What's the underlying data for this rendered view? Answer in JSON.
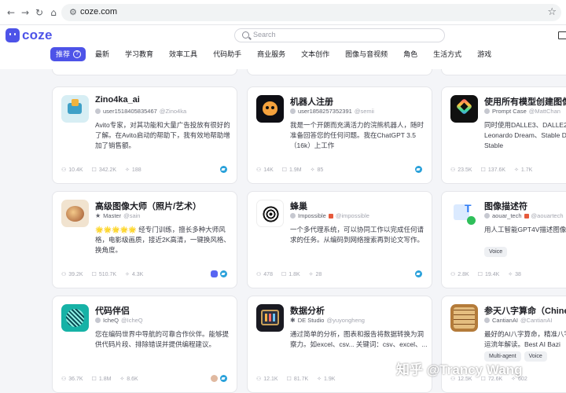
{
  "browser": {
    "url": "coze.com"
  },
  "header": {
    "logo_text": "coze",
    "search_placeholder": "Search"
  },
  "tabs": [
    "推荐",
    "最新",
    "学习教育",
    "效率工具",
    "代码助手",
    "商业服务",
    "文本创作",
    "图像与音视频",
    "角色",
    "生活方式",
    "游戏"
  ],
  "cards": [
    {
      "title": "Zino4ka_ai",
      "author": "user1518405835467",
      "handle": "@Zino4ka",
      "desc": "Avito专家，对其功能和大量广告投放有很好的了解。在Avito启动的帮助下，我有效地帮助增加了销售额。",
      "tags": [],
      "stats": [
        "10.4K",
        "342.2K",
        "188"
      ],
      "icon": "cart-robot-icon"
    },
    {
      "title": "机器人注册",
      "author": "user1858257352391",
      "handle": "@semii",
      "desc": "我是一个开朗而充满活力的浣熊机器人，随时准备回答您的任何问题。我在ChatGPT 3.5（16k）上工作",
      "tags": [],
      "stats": [
        "14K",
        "1.9M",
        "85"
      ],
      "icon": "raccoon-robot-icon"
    },
    {
      "title": "使用所有模型创建图像",
      "author": "Prompt Case",
      "handle": "@MattChan",
      "desc": "同时使用DALLE3、DALLE2、DiffizationXL、Leonardo Dream、Stable DiffizationV1.6、Stable",
      "tags": [],
      "stats": [
        "23.5K",
        "137.6K",
        "1.7K"
      ],
      "icon": "diamond-logo-icon"
    },
    {
      "title": "高级图像大师（照片/艺术）",
      "author": "Master",
      "handle": "@sain",
      "desc": "🌟🌟🌟🌟🌟 经专门训练，擅长多种大师风格，电影级画质，接近2K高清，一键换风格、换角度。",
      "tags": [],
      "stats": [
        "39.2K",
        "510.7K",
        "4.3K"
      ],
      "icon": "art-disc-icon"
    },
    {
      "title": "蜂巢",
      "author": "Impossible",
      "handle": "@impossible",
      "desc": "一个多代理系统，可以协同工作以完成任何请求的任务。从编码到网络搜索再到论文写作。",
      "tags": [],
      "stats": [
        "478",
        "1.8K",
        "28"
      ],
      "icon": "swirl-icon"
    },
    {
      "title": "图像描述符",
      "author": "aouar_tech",
      "handle": "@aouartech",
      "desc": "用人工智能GPT4V描述图像",
      "tags": [
        "Voice"
      ],
      "stats": [
        "2.8K",
        "19.4K",
        "38"
      ],
      "icon": "image-text-icon"
    },
    {
      "title": "代码伴侣",
      "author": "IcheQ",
      "handle": "@IcheQ",
      "desc": "您在编码世界中导航的可靠合作伙伴。能够提供代码片段、排除错误并提供编程建议。",
      "tags": [],
      "stats": [
        "36.7K",
        "1.8M",
        "8.6K"
      ],
      "icon": "code-ball-icon"
    },
    {
      "title": "数据分析",
      "author": "DE Studio",
      "handle": "@yuyongheng",
      "desc": "通过简单的分析，图表和报告将数据转换为洞察力。如excel、csv... 关键词：csv、excel、...",
      "tags": [],
      "stats": [
        "12.1K",
        "81.7K",
        "1.9K"
      ],
      "icon": "data-screen-icon"
    },
    {
      "title": "参天八字算命（Chinese",
      "author": "CantianAI",
      "handle": "@CantianAI",
      "desc": "最好的AI八字算命，精准八字排盘（图片），大运流年解读。Best AI Bazi",
      "tags": [
        "Multi-agent",
        "Voice"
      ],
      "stats": [
        "12.5K",
        "72.6K",
        "602"
      ],
      "icon": "bazi-board-icon"
    }
  ],
  "watermark": "知乎 @Trancy Wang",
  "colors": {
    "brand": "#4d53e8",
    "telegram": "#2aa1da",
    "discord": "#5865f2"
  }
}
